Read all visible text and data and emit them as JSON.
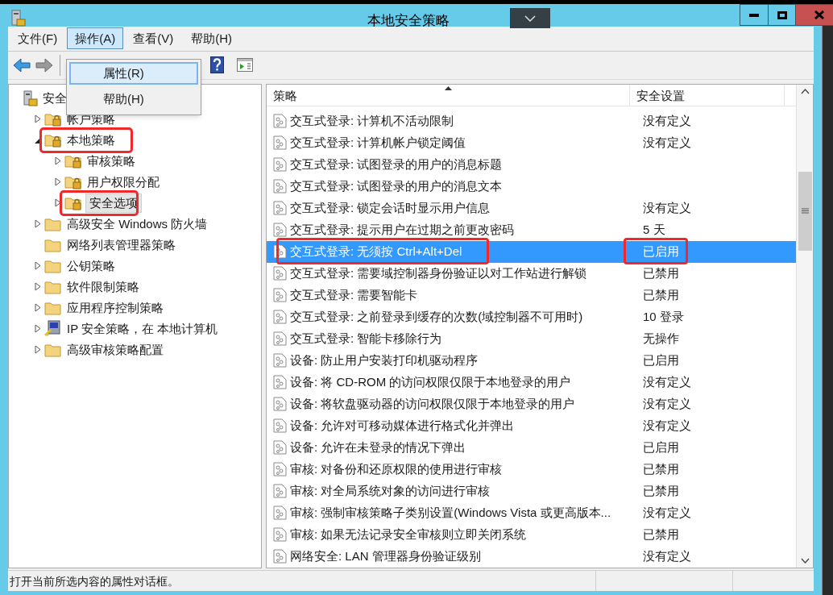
{
  "window": {
    "title": "本地安全策略"
  },
  "menu_bar": [
    {
      "label": "文件(F)",
      "selected": false
    },
    {
      "label": "操作(A)",
      "selected": true
    },
    {
      "label": "查看(V)",
      "selected": false
    },
    {
      "label": "帮助(H)",
      "selected": false
    }
  ],
  "open_menu": {
    "items": [
      {
        "label": "属性(R)",
        "selected": true
      },
      {
        "label": "帮助(H)",
        "selected": false
      }
    ]
  },
  "tree": {
    "items": [
      {
        "label": "安全",
        "kind": "root",
        "expandable": false,
        "selected": false,
        "annotated": false,
        "children": [
          {
            "label": "帐户策略",
            "kind": "folder-lock",
            "expandable": true,
            "expanded": false,
            "selected": false,
            "annotated": false
          },
          {
            "label": "本地策略",
            "kind": "folder-lock",
            "expandable": true,
            "expanded": true,
            "selected": false,
            "annotated": true,
            "children": [
              {
                "label": "审核策略",
                "kind": "folder-lock",
                "expandable": true,
                "expanded": false,
                "selected": false,
                "annotated": false
              },
              {
                "label": "用户权限分配",
                "kind": "folder-lock",
                "expandable": true,
                "expanded": false,
                "selected": false,
                "annotated": false
              },
              {
                "label": "安全选项",
                "kind": "folder-lock",
                "expandable": true,
                "expanded": false,
                "selected": true,
                "annotated": true
              }
            ]
          },
          {
            "label": "高级安全 Windows 防火墙",
            "kind": "folder",
            "expandable": true,
            "expanded": false,
            "selected": false,
            "annotated": false
          },
          {
            "label": "网络列表管理器策略",
            "kind": "folder",
            "expandable": false,
            "selected": false,
            "annotated": false
          },
          {
            "label": "公钥策略",
            "kind": "folder",
            "expandable": true,
            "expanded": false,
            "selected": false,
            "annotated": false
          },
          {
            "label": "软件限制策略",
            "kind": "folder",
            "expandable": true,
            "expanded": false,
            "selected": false,
            "annotated": false
          },
          {
            "label": "应用程序控制策略",
            "kind": "folder",
            "expandable": true,
            "expanded": false,
            "selected": false,
            "annotated": false
          },
          {
            "label": "IP 安全策略，在 本地计算机",
            "kind": "computer",
            "expandable": true,
            "expanded": false,
            "selected": false,
            "annotated": false
          },
          {
            "label": "高级审核策略配置",
            "kind": "folder",
            "expandable": true,
            "expanded": false,
            "selected": false,
            "annotated": false
          }
        ]
      }
    ]
  },
  "table": {
    "columns": [
      "策略",
      "安全设置"
    ],
    "rows": [
      {
        "policy": "交互式登录: 计算机不活动限制",
        "setting": "没有定义",
        "selected": false,
        "annotated": false
      },
      {
        "policy": "交互式登录: 计算机帐户锁定阈值",
        "setting": "没有定义",
        "selected": false,
        "annotated": false
      },
      {
        "policy": "交互式登录: 试图登录的用户的消息标题",
        "setting": "",
        "selected": false,
        "annotated": false
      },
      {
        "policy": "交互式登录: 试图登录的用户的消息文本",
        "setting": "",
        "selected": false,
        "annotated": false
      },
      {
        "policy": "交互式登录: 锁定会话时显示用户信息",
        "setting": "没有定义",
        "selected": false,
        "annotated": false
      },
      {
        "policy": "交互式登录: 提示用户在过期之前更改密码",
        "setting": "5 天",
        "selected": false,
        "annotated": false
      },
      {
        "policy": "交互式登录: 无须按 Ctrl+Alt+Del",
        "setting": "已启用",
        "selected": true,
        "annotated": true
      },
      {
        "policy": "交互式登录: 需要域控制器身份验证以对工作站进行解锁",
        "setting": "已禁用",
        "selected": false,
        "annotated": false
      },
      {
        "policy": "交互式登录: 需要智能卡",
        "setting": "已禁用",
        "selected": false,
        "annotated": false
      },
      {
        "policy": "交互式登录: 之前登录到缓存的次数(域控制器不可用时)",
        "setting": "10 登录",
        "selected": false,
        "annotated": false
      },
      {
        "policy": "交互式登录: 智能卡移除行为",
        "setting": "无操作",
        "selected": false,
        "annotated": false
      },
      {
        "policy": "设备: 防止用户安装打印机驱动程序",
        "setting": "已启用",
        "selected": false,
        "annotated": false
      },
      {
        "policy": "设备: 将 CD-ROM 的访问权限仅限于本地登录的用户",
        "setting": "没有定义",
        "selected": false,
        "annotated": false
      },
      {
        "policy": "设备: 将软盘驱动器的访问权限仅限于本地登录的用户",
        "setting": "没有定义",
        "selected": false,
        "annotated": false
      },
      {
        "policy": "设备: 允许对可移动媒体进行格式化并弹出",
        "setting": "没有定义",
        "selected": false,
        "annotated": false
      },
      {
        "policy": "设备: 允许在未登录的情况下弹出",
        "setting": "已启用",
        "selected": false,
        "annotated": false
      },
      {
        "policy": "审核: 对备份和还原权限的使用进行审核",
        "setting": "已禁用",
        "selected": false,
        "annotated": false
      },
      {
        "policy": "审核: 对全局系统对象的访问进行审核",
        "setting": "已禁用",
        "selected": false,
        "annotated": false
      },
      {
        "policy": "审核: 强制审核策略子类别设置(Windows Vista 或更高版本...",
        "setting": "没有定义",
        "selected": false,
        "annotated": false
      },
      {
        "policy": "审核: 如果无法记录安全审核则立即关闭系统",
        "setting": "已禁用",
        "selected": false,
        "annotated": false
      },
      {
        "policy": "网络安全: LAN 管理器身份验证级别",
        "setting": "没有定义",
        "selected": false,
        "annotated": false
      }
    ]
  },
  "status_bar": {
    "text": "打开当前所选内容的属性对话框。"
  }
}
